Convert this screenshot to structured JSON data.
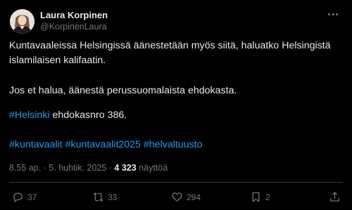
{
  "author": {
    "name": "Laura Korpinen",
    "handle": "@KorpinenLaura"
  },
  "post": {
    "line1": "Kuntavaaleissa Helsingissä äänestetään myös siitä, haluatko Helsingistä",
    "line2": "islamilaisen kalifaatin.",
    "line3": "Jos et halua, äänestä perussuomalaista ehdokasta.",
    "hashtag_helsinki": "#Helsinki",
    "line4_rest": " ehdokasnro 386.",
    "hashtags": [
      "#kuntavaalit",
      "#kuntavaalit2025",
      "#helvaltuusto"
    ]
  },
  "meta": {
    "time": "8.55 ap.",
    "separator": " · ",
    "date": "5. huhtik. 2025",
    "views_count": "4 323",
    "views_label": " näyttöä"
  },
  "actions": {
    "replies": "37",
    "reposts": "33",
    "likes": "294",
    "bookmarks": "2"
  },
  "colors": {
    "background": "#000000",
    "text": "#e7e9ea",
    "muted": "#71767b",
    "link": "#1d9bf0",
    "divider": "#2f3336"
  }
}
